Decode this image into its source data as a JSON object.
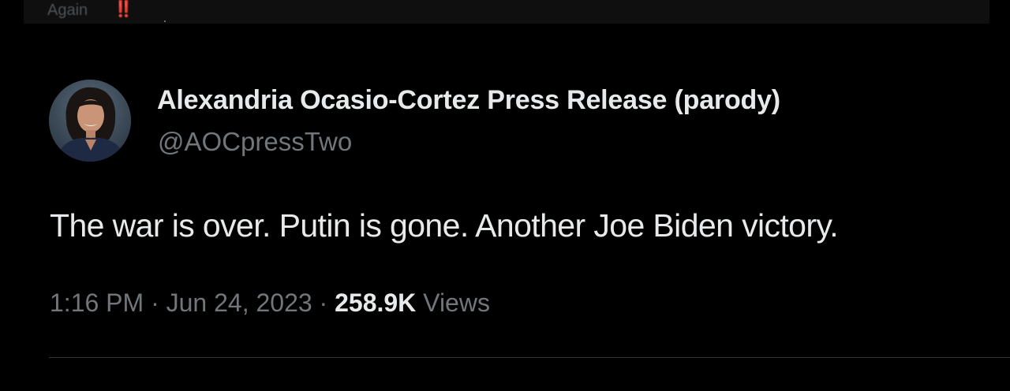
{
  "previous_tweet": {
    "text": "Again",
    "emoji": "‼️"
  },
  "tweet": {
    "author_name": "Alexandria Ocasio-Cortez Press Release (parody)",
    "author_handle": "@AOCpressTwo",
    "text": "The war is over. Putin is gone. Another Joe Biden victory.",
    "time": "1:16 PM",
    "date": "Jun 24, 2023",
    "separator": "·",
    "views_count": "258.9K",
    "views_label": "Views"
  },
  "colors": {
    "background": "#000000",
    "primary_text": "#e7e9ea",
    "secondary_text": "#71767b",
    "divider": "#2f3336"
  }
}
